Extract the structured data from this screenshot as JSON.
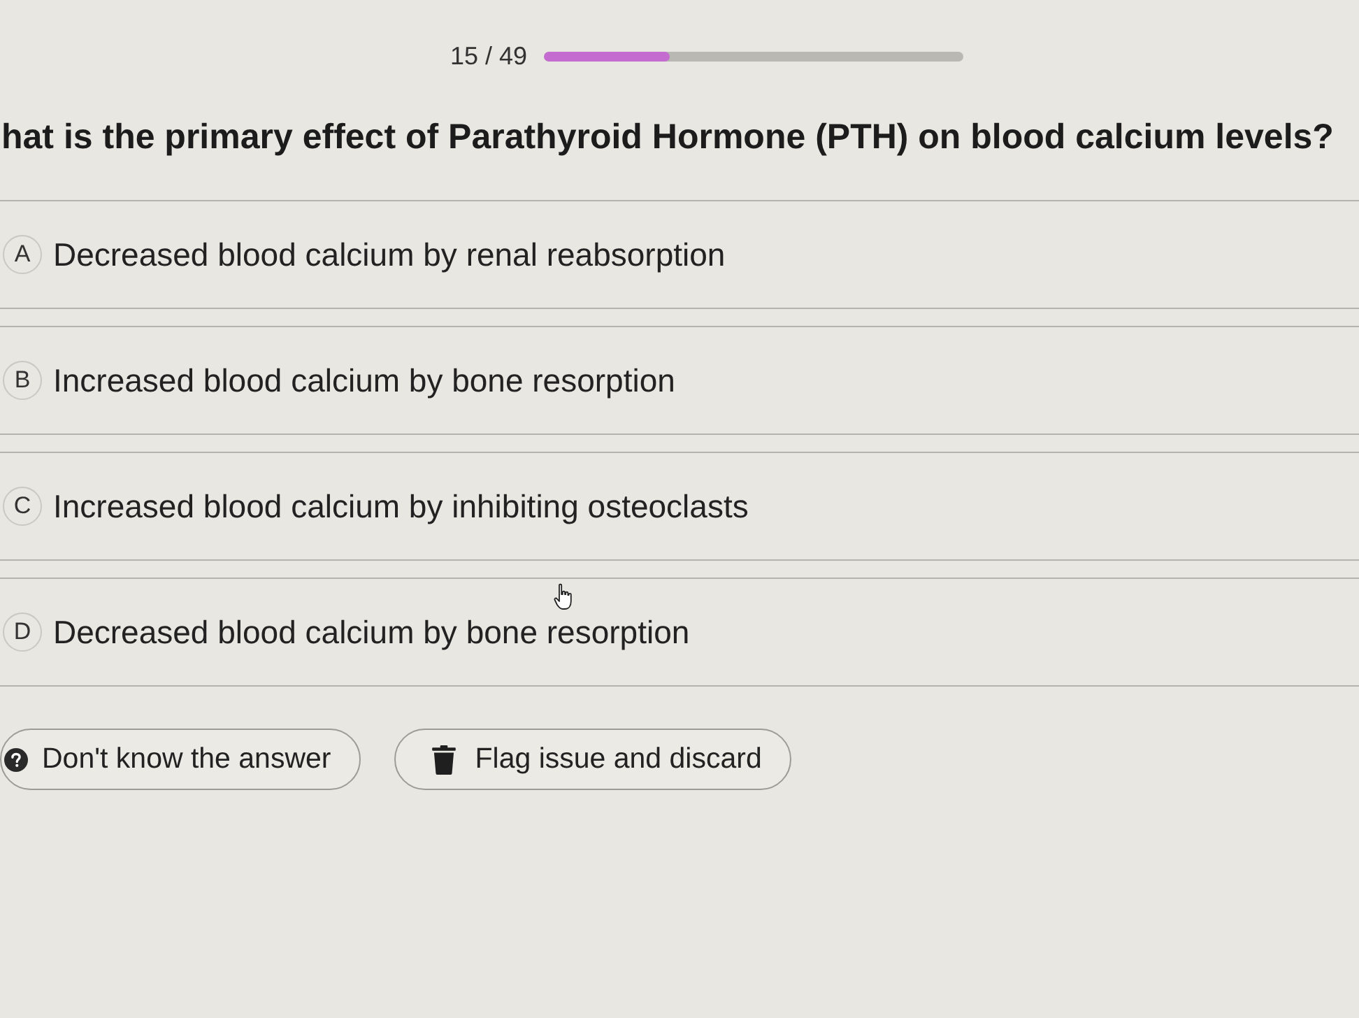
{
  "progress": {
    "counter": "15 / 49",
    "level": 0.3
  },
  "question": "hat is the primary effect of Parathyroid Hormone (PTH) on blood calcium levels?",
  "options": [
    {
      "letter": "A",
      "text": "Decreased blood calcium by renal reabsorption",
      "selected": false
    },
    {
      "letter": "B",
      "text": "Increased blood calcium by bone resorption",
      "selected": false
    },
    {
      "letter": "C",
      "text": "Increased blood calcium by inhibiting osteoclasts",
      "selected": false
    },
    {
      "letter": "D",
      "text": "Decreased blood calcium by bone resorption",
      "selected": false
    }
  ],
  "actions": [
    {
      "kind": "unknown",
      "label": "Don't know the answer"
    },
    {
      "kind": "flag",
      "label": "Flag issue and discard"
    }
  ]
}
